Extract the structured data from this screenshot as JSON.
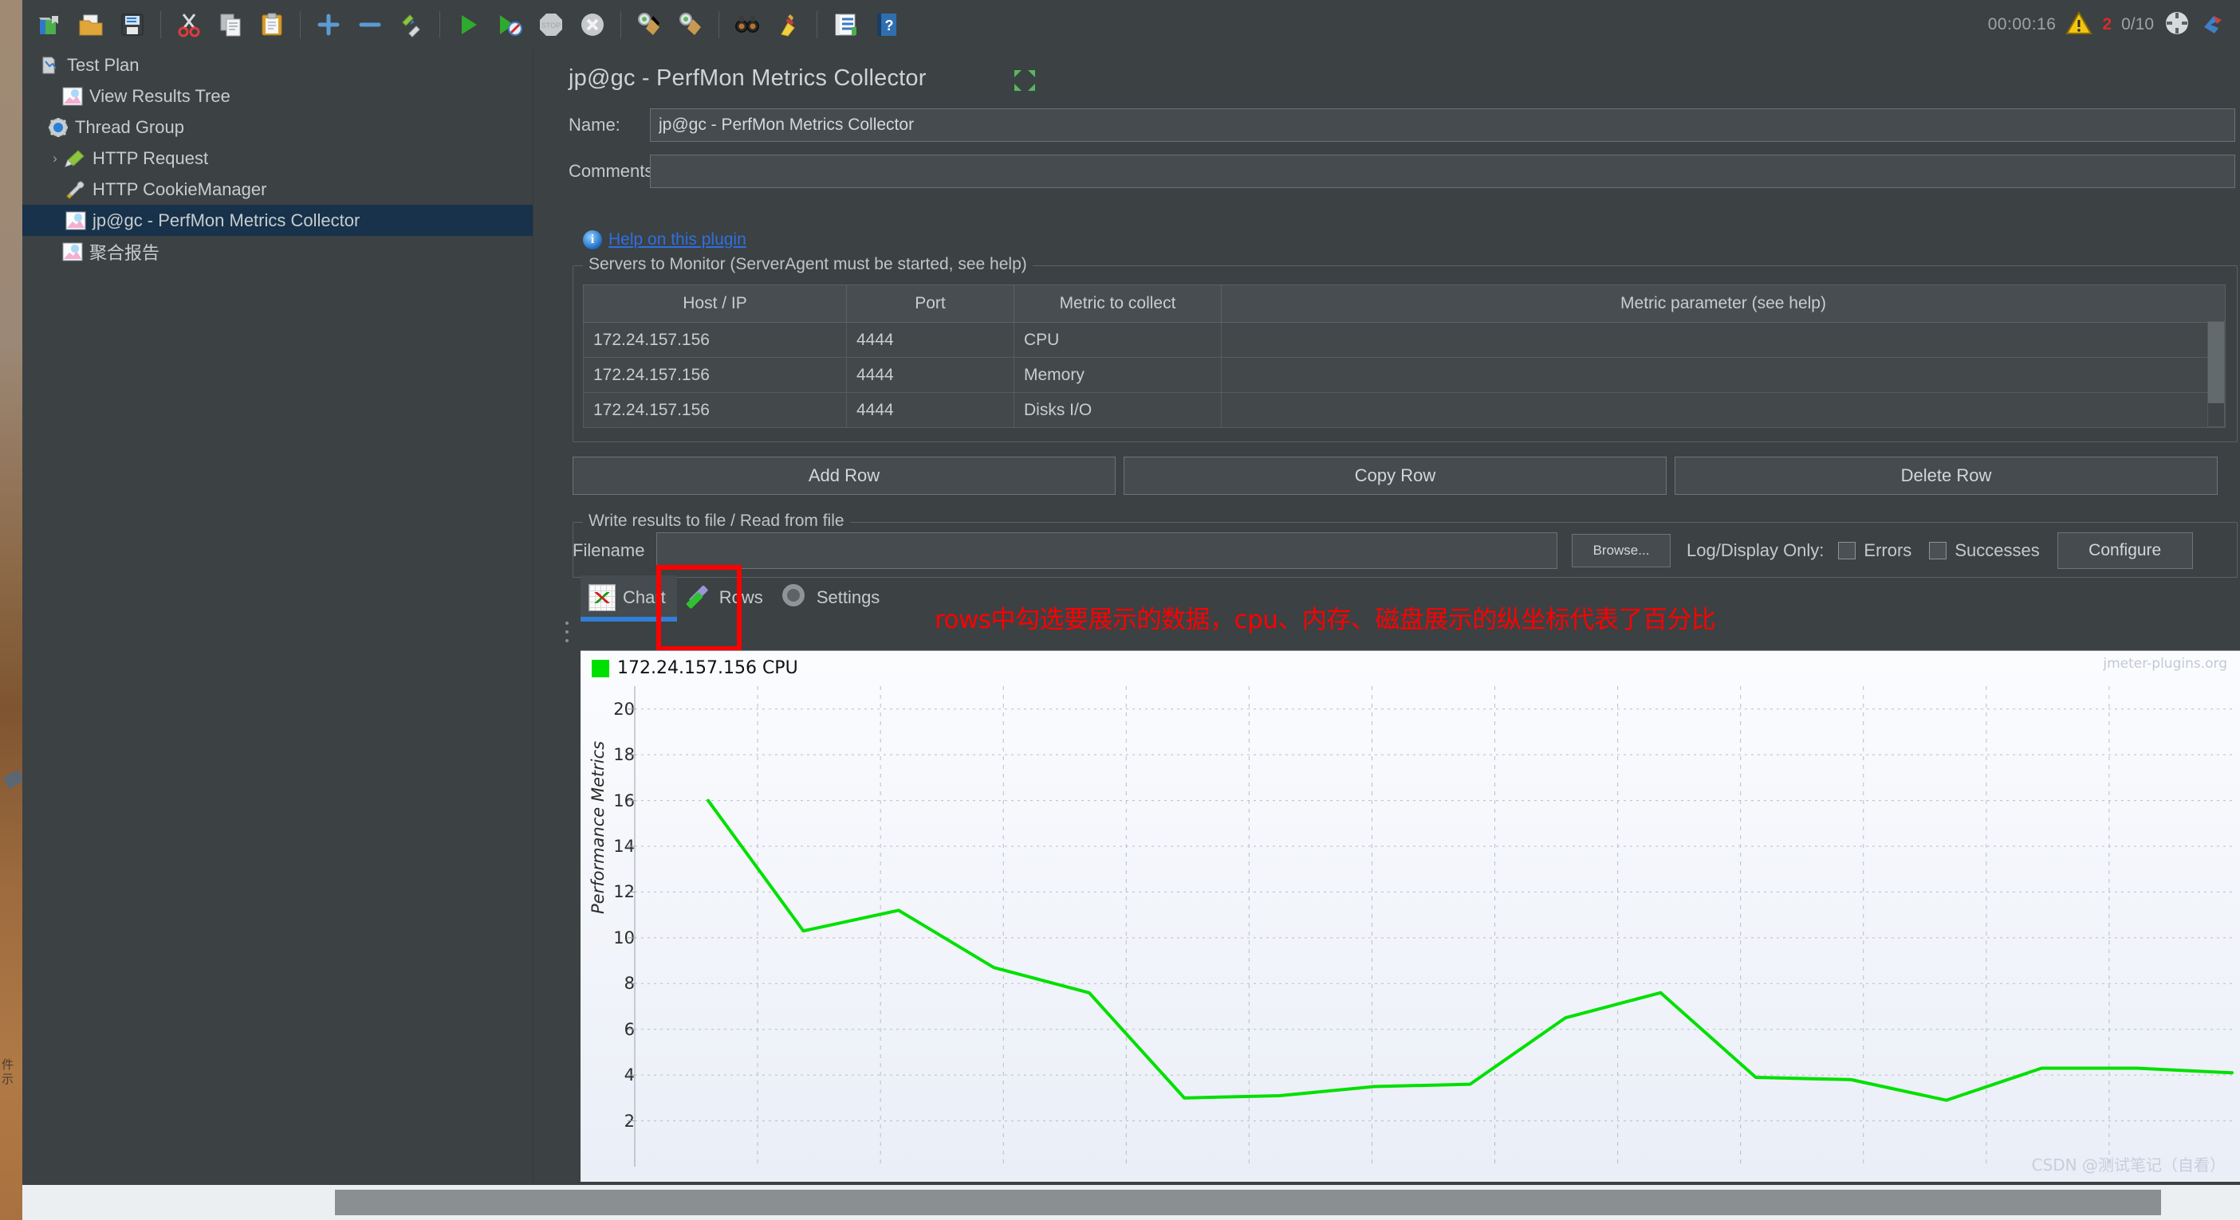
{
  "toolbar": {
    "icons": [
      {
        "name": "new-test-plan-icon",
        "glyph": "📗"
      },
      {
        "name": "open-icon",
        "glyph": "📂"
      },
      {
        "name": "save-icon",
        "glyph": "💾"
      },
      {
        "name": "cut-icon",
        "glyph": "✂"
      },
      {
        "name": "copy-icon",
        "glyph": "🗐"
      },
      {
        "name": "paste-icon",
        "glyph": "📋"
      },
      {
        "name": "expand-all-icon",
        "glyph": "✚"
      },
      {
        "name": "collapse-all-icon",
        "glyph": "－"
      },
      {
        "name": "toggle-icon",
        "glyph": "🖉"
      },
      {
        "name": "start-icon",
        "glyph": "▶"
      },
      {
        "name": "start-no-pauses-icon",
        "glyph": "▶"
      },
      {
        "name": "stop-icon",
        "glyph": "STOP"
      },
      {
        "name": "shutdown-icon",
        "glyph": "✖"
      },
      {
        "name": "clear-icon",
        "glyph": "🧹"
      },
      {
        "name": "clear-all-icon",
        "glyph": "🧹"
      },
      {
        "name": "search-icon",
        "glyph": "🔍"
      },
      {
        "name": "reset-search-icon",
        "glyph": "🧹"
      },
      {
        "name": "function-helper-icon",
        "glyph": "📑"
      },
      {
        "name": "help-icon",
        "glyph": "?"
      }
    ],
    "elapsed_time": "00:00:16",
    "warning_count": "2",
    "thread_count": "0/10",
    "gear_status_icon": "status-gear-icon",
    "notify_icon": "notify-icon"
  },
  "tree": {
    "nodes": [
      {
        "label": "Test Plan",
        "icon": "test-plan-icon",
        "depth": 0,
        "toggle": "",
        "selected": false
      },
      {
        "label": "View Results Tree",
        "icon": "view-results-tree-icon",
        "depth": 1,
        "toggle": "",
        "selected": false
      },
      {
        "label": "Thread Group",
        "icon": "thread-group-icon",
        "depth": 1,
        "toggle": "",
        "selected": false
      },
      {
        "label": "HTTP Request",
        "icon": "http-request-icon",
        "depth": 2,
        "toggle": "›",
        "selected": false
      },
      {
        "label": "HTTP CookieManager",
        "icon": "http-cookie-manager-icon",
        "depth": 2,
        "toggle": "",
        "selected": false
      },
      {
        "label": "jp@gc - PerfMon Metrics Collector",
        "icon": "perfmon-icon",
        "depth": 3,
        "toggle": "",
        "selected": true
      },
      {
        "label": "聚合报告",
        "icon": "aggregate-report-icon",
        "depth": 1,
        "toggle": "",
        "selected": false
      }
    ]
  },
  "panel": {
    "title": "jp@gc - PerfMon Metrics Collector",
    "expand_icon": "expand-arrows-icon",
    "name_label": "Name:",
    "name_value": "jp@gc - PerfMon Metrics Collector",
    "comments_label": "Comments:",
    "comments_value": "",
    "help_link": "Help on this plugin",
    "info_icon": "info-icon"
  },
  "servers": {
    "legend": "Servers to Monitor (ServerAgent must be started, see help)",
    "columns": [
      "Host / IP",
      "Port",
      "Metric to collect",
      "Metric parameter (see help)"
    ],
    "rows": [
      [
        "172.24.157.156",
        "4444",
        "CPU",
        ""
      ],
      [
        "172.24.157.156",
        "4444",
        "Memory",
        ""
      ],
      [
        "172.24.157.156",
        "4444",
        "Disks I/O",
        ""
      ]
    ]
  },
  "row_buttons": {
    "add": "Add Row",
    "copy": "Copy Row",
    "delete": "Delete Row"
  },
  "file_section": {
    "legend": "Write results to file / Read from file",
    "filename_label": "Filename",
    "filename_value": "",
    "browse": "Browse...",
    "log_display_label": "Log/Display Only:",
    "errors": "Errors",
    "successes": "Successes",
    "configure": "Configure",
    "errors_checked": false,
    "successes_checked": false
  },
  "tabs": [
    {
      "label": "Chart",
      "icon": "chart-tab-icon",
      "active": true
    },
    {
      "label": "Rows",
      "icon": "rows-check-icon",
      "active": false
    },
    {
      "label": "Settings",
      "icon": "settings-gear-icon",
      "active": false
    }
  ],
  "annotation": {
    "text": "rows中勾选要展示的数据，cpu、内存、磁盘展示的纵坐标代表了百分比",
    "color": "#ff0000",
    "highlight_target": "rows-tab"
  },
  "chart_watermarks": {
    "plugin": "jmeter-plugins.org",
    "author": "CSDN @测试笔记（自看）"
  },
  "chart_data": {
    "type": "line",
    "title": "",
    "xlabel": "",
    "ylabel": "Performance Metrics",
    "ylim": [
      0,
      21
    ],
    "yticks": [
      2,
      4,
      6,
      8,
      10,
      12,
      14,
      16,
      18,
      20
    ],
    "grid": true,
    "legend_position": "top-left",
    "series": [
      {
        "name": "172.24.157.156 CPU",
        "color": "#00e000",
        "x": [
          0,
          1,
          2,
          3,
          4,
          5,
          6,
          7,
          8,
          9,
          10,
          11,
          12,
          13,
          14,
          15,
          16
        ],
        "values": [
          16.0,
          10.3,
          11.2,
          8.7,
          7.6,
          3.0,
          3.1,
          3.5,
          3.6,
          6.5,
          7.6,
          3.9,
          3.8,
          2.9,
          4.3,
          4.3,
          4.1
        ]
      }
    ]
  },
  "bottom_scrollbar": {
    "name": "horizontal-scrollbar"
  },
  "desktop": {
    "side_text": "件\n示"
  }
}
